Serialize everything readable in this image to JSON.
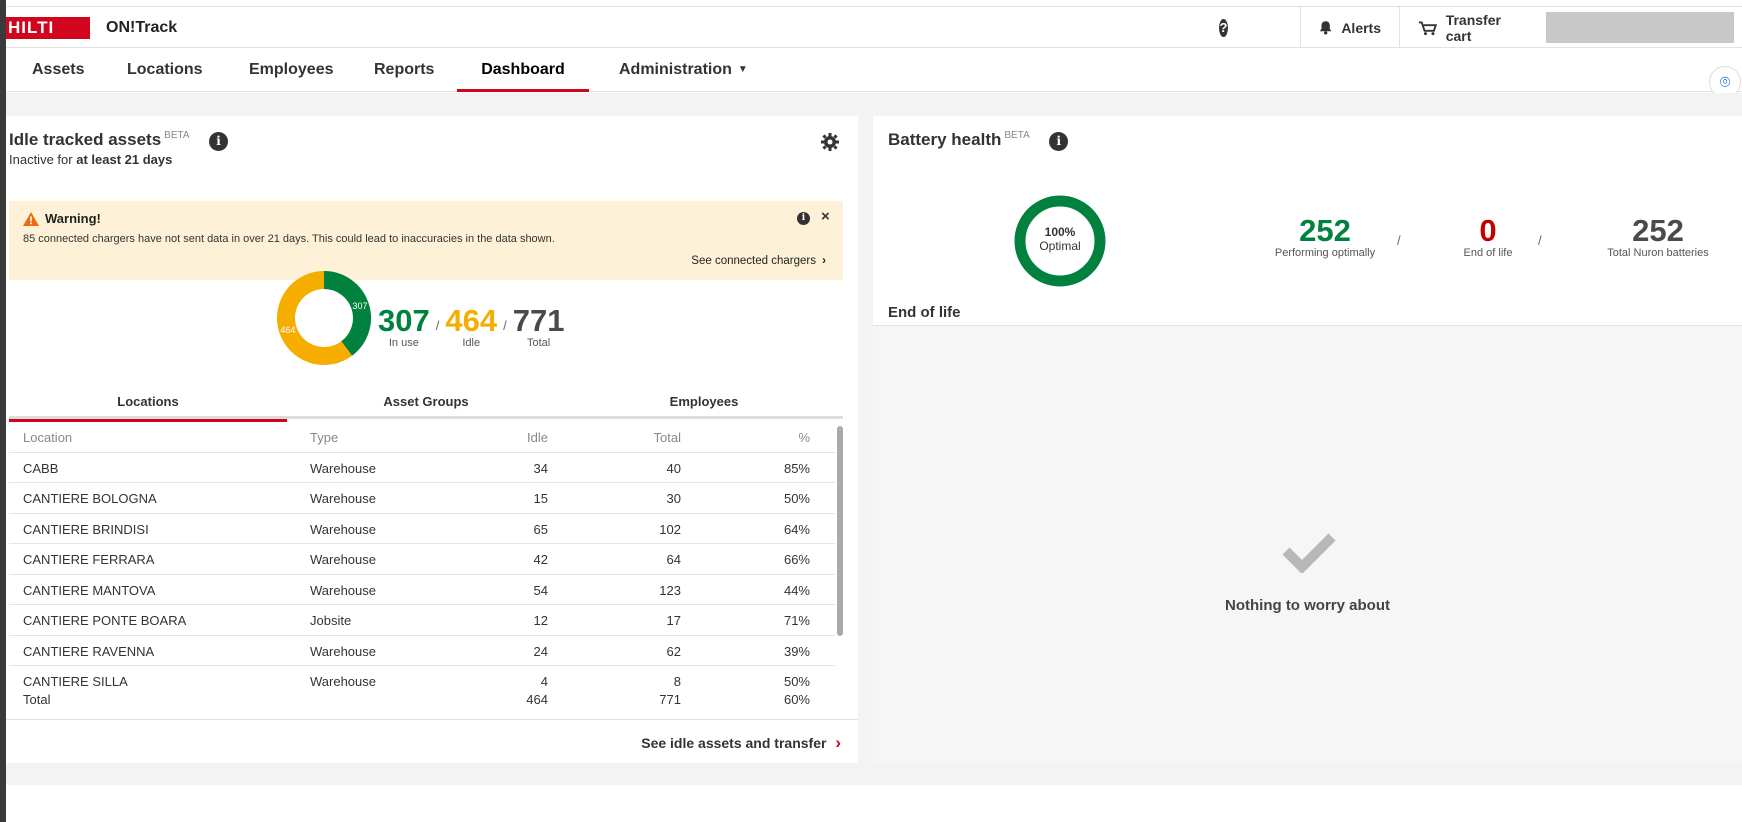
{
  "app": {
    "logo_text": "HILTI",
    "name": "ON!Track",
    "brand_color": "#d2051e"
  },
  "topbar": {
    "help_icon": "question-circle-icon",
    "alerts_label": "Alerts",
    "transfer_cart_label": "Transfer cart"
  },
  "nav": {
    "tabs": [
      {
        "label": "Assets"
      },
      {
        "label": "Locations"
      },
      {
        "label": "Employees"
      },
      {
        "label": "Reports"
      },
      {
        "label": "Dashboard",
        "active": true
      },
      {
        "label": "Administration",
        "has_dropdown": true
      }
    ]
  },
  "idle": {
    "title": "Idle tracked assets",
    "beta": "BETA",
    "subtitle_prefix": "Inactive for",
    "subtitle_bold": "at least 21 days",
    "warning": {
      "title": "Warning!",
      "text": "85 connected chargers have not sent data in over 21 days. This could lead to inaccuracies in the data shown.",
      "link": "See connected chargers"
    },
    "donut": {
      "in_use": 307,
      "idle": 464,
      "in_use_label": "307",
      "idle_label": "464"
    },
    "kpis": {
      "in_use": "307",
      "in_use_label": "In use",
      "idle": "464",
      "idle_label": "Idle",
      "total": "771",
      "total_label": "Total",
      "sep": "/"
    },
    "tabs": [
      {
        "label": "Locations",
        "active": true
      },
      {
        "label": "Asset Groups"
      },
      {
        "label": "Employees"
      }
    ],
    "table": {
      "headers": [
        "Location",
        "Type",
        "Idle",
        "Total",
        "%"
      ],
      "rows": [
        [
          "CABB",
          "Warehouse",
          "34",
          "40",
          "85%"
        ],
        [
          "CANTIERE BOLOGNA",
          "Warehouse",
          "15",
          "30",
          "50%"
        ],
        [
          "CANTIERE BRINDISI",
          "Warehouse",
          "65",
          "102",
          "64%"
        ],
        [
          "CANTIERE FERRARA",
          "Warehouse",
          "42",
          "64",
          "66%"
        ],
        [
          "CANTIERE MANTOVA",
          "Warehouse",
          "54",
          "123",
          "44%"
        ],
        [
          "CANTIERE PONTE BOARA",
          "Jobsite",
          "12",
          "17",
          "71%"
        ],
        [
          "CANTIERE RAVENNA",
          "Warehouse",
          "24",
          "62",
          "39%"
        ],
        [
          "CANTIERE SILLA",
          "Warehouse",
          "4",
          "8",
          "50%"
        ]
      ],
      "total": [
        "Total",
        "",
        "464",
        "771",
        "60%"
      ]
    },
    "footer_link": "See idle assets and transfer"
  },
  "battery": {
    "title": "Battery health",
    "beta": "BETA",
    "donut_pct": "100%",
    "donut_label": "Optimal",
    "optimal_fraction": 1.0,
    "kpis": {
      "performing": "252",
      "performing_label": "Performing optimally",
      "eol": "0",
      "eol_label": "End of life",
      "total": "252",
      "total_label": "Total Nuron batteries",
      "sep": "/"
    },
    "eol_section": "End of life",
    "empty_message": "Nothing to worry about"
  },
  "colors": {
    "green": "#00813e",
    "orange": "#f5ad00",
    "red": "#c40000",
    "gray": "#4a4a4a"
  }
}
